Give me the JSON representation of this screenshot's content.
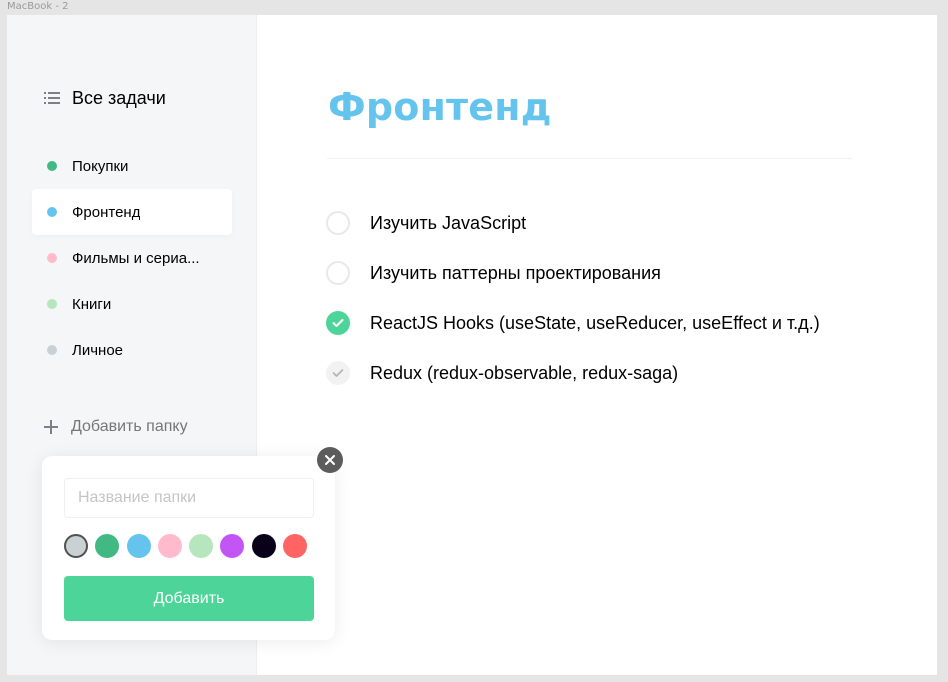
{
  "window": {
    "frame_label": "MacBook - 2"
  },
  "sidebar": {
    "all_tasks": {
      "label": "Все задачи",
      "icon": "list-icon"
    },
    "folders": [
      {
        "label": "Покупки",
        "color": "#42b883",
        "active": false
      },
      {
        "label": "Фронтенд",
        "color": "#64c4ed",
        "active": true
      },
      {
        "label": "Фильмы и сериа...",
        "color": "#ffbbcc",
        "active": false
      },
      {
        "label": "Книги",
        "color": "#b6e6bd",
        "active": false
      },
      {
        "label": "Личное",
        "color": "#c9d1d3",
        "active": false
      }
    ],
    "add_folder": {
      "label": "Добавить папку",
      "icon": "plus-icon"
    }
  },
  "popup": {
    "input": {
      "value": "",
      "placeholder": "Название папки"
    },
    "colors": [
      "#c9d1d3",
      "#42b883",
      "#64c4ed",
      "#ffbbcc",
      "#b6e6bd",
      "#c355f5",
      "#09011a",
      "#ff6464"
    ],
    "selected_color_index": 0,
    "button_label": "Добавить",
    "close_icon": "close-icon"
  },
  "main": {
    "title": "Фронтенд",
    "title_color": "#64c4ed",
    "tasks": [
      {
        "label": "Изучить JavaScript",
        "completed": false
      },
      {
        "label": "Изучить паттерны проектирования",
        "completed": false
      },
      {
        "label": "ReactJS Hooks (useState, useReducer, useEffect и т.д.)",
        "completed": true
      },
      {
        "label": "Redux (redux-observable, redux-saga)",
        "completed": "hover"
      }
    ]
  },
  "colors": {
    "accent_green": "#4dd599",
    "close_bg": "#5c5c5c"
  }
}
